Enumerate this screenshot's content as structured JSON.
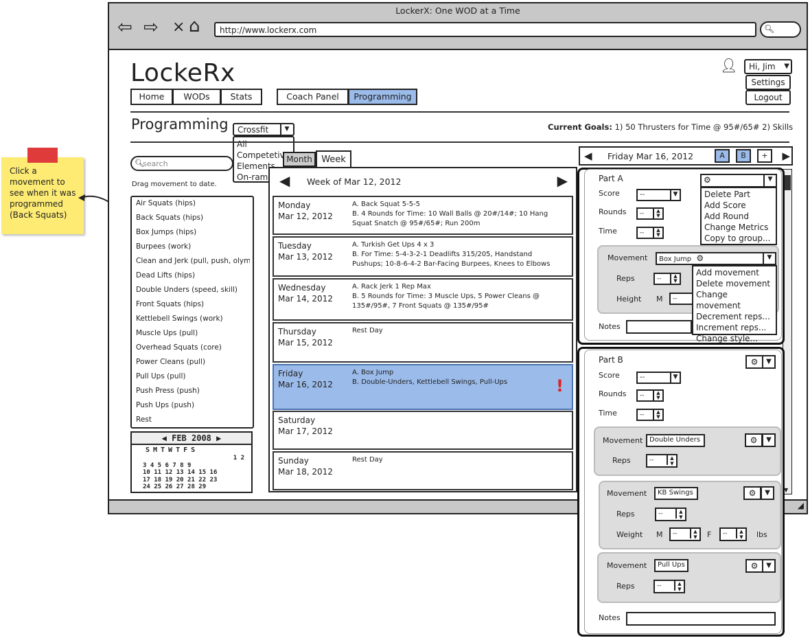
{
  "browser": {
    "title": "LockerX: One WOD at a Time",
    "url": "http://www.lockerx.com"
  },
  "sticky": {
    "text": "Click a movement to see when it was programmed (Back Squats)"
  },
  "app": {
    "logo": "LockeRx",
    "nav": [
      "Home",
      "WODs",
      "Stats"
    ],
    "nav2": [
      "Coach Panel",
      "Programming"
    ],
    "user": {
      "greeting": "Hi, Jim",
      "menu": [
        "Settings",
        "Logout"
      ]
    },
    "page_title": "Programming",
    "program_select": "Crossfit",
    "program_options": [
      "All",
      "Competetiv",
      "Elements",
      "On-ramp"
    ],
    "goals_label": "Current Goals:",
    "goals_text": "1) 50 Thrusters for Time @ 95#/65#  2) Skills"
  },
  "sidebar": {
    "search_placeholder": "search",
    "hint": "Drag movement to date.",
    "movements": [
      "Air Squats (hips)",
      "Back Squats (hips)",
      "Box Jumps (hips)",
      "Burpees (work)",
      "Clean and Jerk (pull, push, olympi",
      "Dead Lifts (hips)",
      "Double Unders (speed, skill)",
      "Front Squats (hips)",
      "Kettlebell Swings (work)",
      "Muscle Ups (pull)",
      "Overhead Squats (core)",
      "Power Cleans (pull)",
      "Pull Ups (pull)",
      "Push Press (push)",
      "Push Ups (push)",
      "Rest"
    ],
    "calendar": {
      "month": "FEB 2008",
      "weekdays": "SMTWTFS",
      "rows": [
        "1 2",
        "3 4 5 6 7 8 9",
        "10 11 12 13 14 15 16",
        "17 18 19 20 21 22 23",
        "24 25 26 27 28 29"
      ]
    }
  },
  "calendar_view": {
    "tabs": [
      "Month",
      "Week"
    ],
    "week_label": "Week of Mar 12, 2012",
    "days": [
      {
        "day": "Monday",
        "date": "Mar 12, 2012",
        "lines": [
          "A. Back Squat 5-5-5",
          "B. 4 Rounds for Time: 10 Wall Balls @ 20#/14#; 10 Hang",
          "Squat Snatch @ 95#/65#; Run 200m"
        ]
      },
      {
        "day": "Tuesday",
        "date": "Mar 13, 2012",
        "lines": [
          "A. Turkish Get Ups 4 x 3",
          "B. For Time: 5-4-3-2-1 Deadlifts 315/205, Handstand",
          "Pushups; 10-8-6-4-2 Bar-Facing Burpees, Knees to Elbows"
        ]
      },
      {
        "day": "Wednesday",
        "date": "Mar 14, 2012",
        "lines": [
          "A.  Rack Jerk 1 Rep Max",
          "B.  5 Rounds for Time: 3 Muscle Ups, 5 Power Cleans @",
          "135#/95#, 7 Front Squats @ 135#/95#"
        ]
      },
      {
        "day": "Thursday",
        "date": "Mar 15, 2012",
        "lines": [
          "Rest Day"
        ]
      },
      {
        "day": "Friday",
        "date": "Mar 16, 2012",
        "lines": [
          "A. Box Jump",
          "B. Double-Unders, Kettlebell Swings, Pull-Ups"
        ]
      },
      {
        "day": "Saturday",
        "date": "Mar 17, 2012",
        "lines": []
      },
      {
        "day": "Sunday",
        "date": "Mar 18, 2012",
        "lines": [
          "Rest Day"
        ]
      }
    ],
    "alert": "!"
  },
  "detail": {
    "date_label": "Friday Mar 16, 2012",
    "buttons": [
      "A",
      "B",
      "+"
    ],
    "partA": {
      "title": "Part A",
      "fields": [
        "Score",
        "Rounds",
        "Time"
      ],
      "value": "--",
      "gear_menu": [
        "Delete Part",
        "Add Score",
        "Add Round",
        "Change Metrics",
        "Copy to group..."
      ],
      "movement_label": "Movement",
      "movement": "Box Jump",
      "reps_label": "Reps",
      "height_label": "Height",
      "m_label": "M",
      "movement_menu": [
        "Add movement",
        "Delete movement",
        "Change movement",
        "Decrement reps...",
        "Increment reps...",
        "Change style..."
      ],
      "notes_label": "Notes"
    },
    "partB": {
      "title": "Part B",
      "fields": [
        "Score",
        "Rounds",
        "Time"
      ],
      "movements": [
        {
          "label": "Movement",
          "name": "Double Unders",
          "reps": "Reps"
        },
        {
          "label": "Movement",
          "name": "KB Swings",
          "reps": "Reps",
          "weight": "Weight",
          "m": "M",
          "f": "F",
          "unit": "lbs"
        },
        {
          "label": "Movement",
          "name": "Pull Ups",
          "reps": "Reps"
        }
      ],
      "notes_label": "Notes"
    }
  }
}
